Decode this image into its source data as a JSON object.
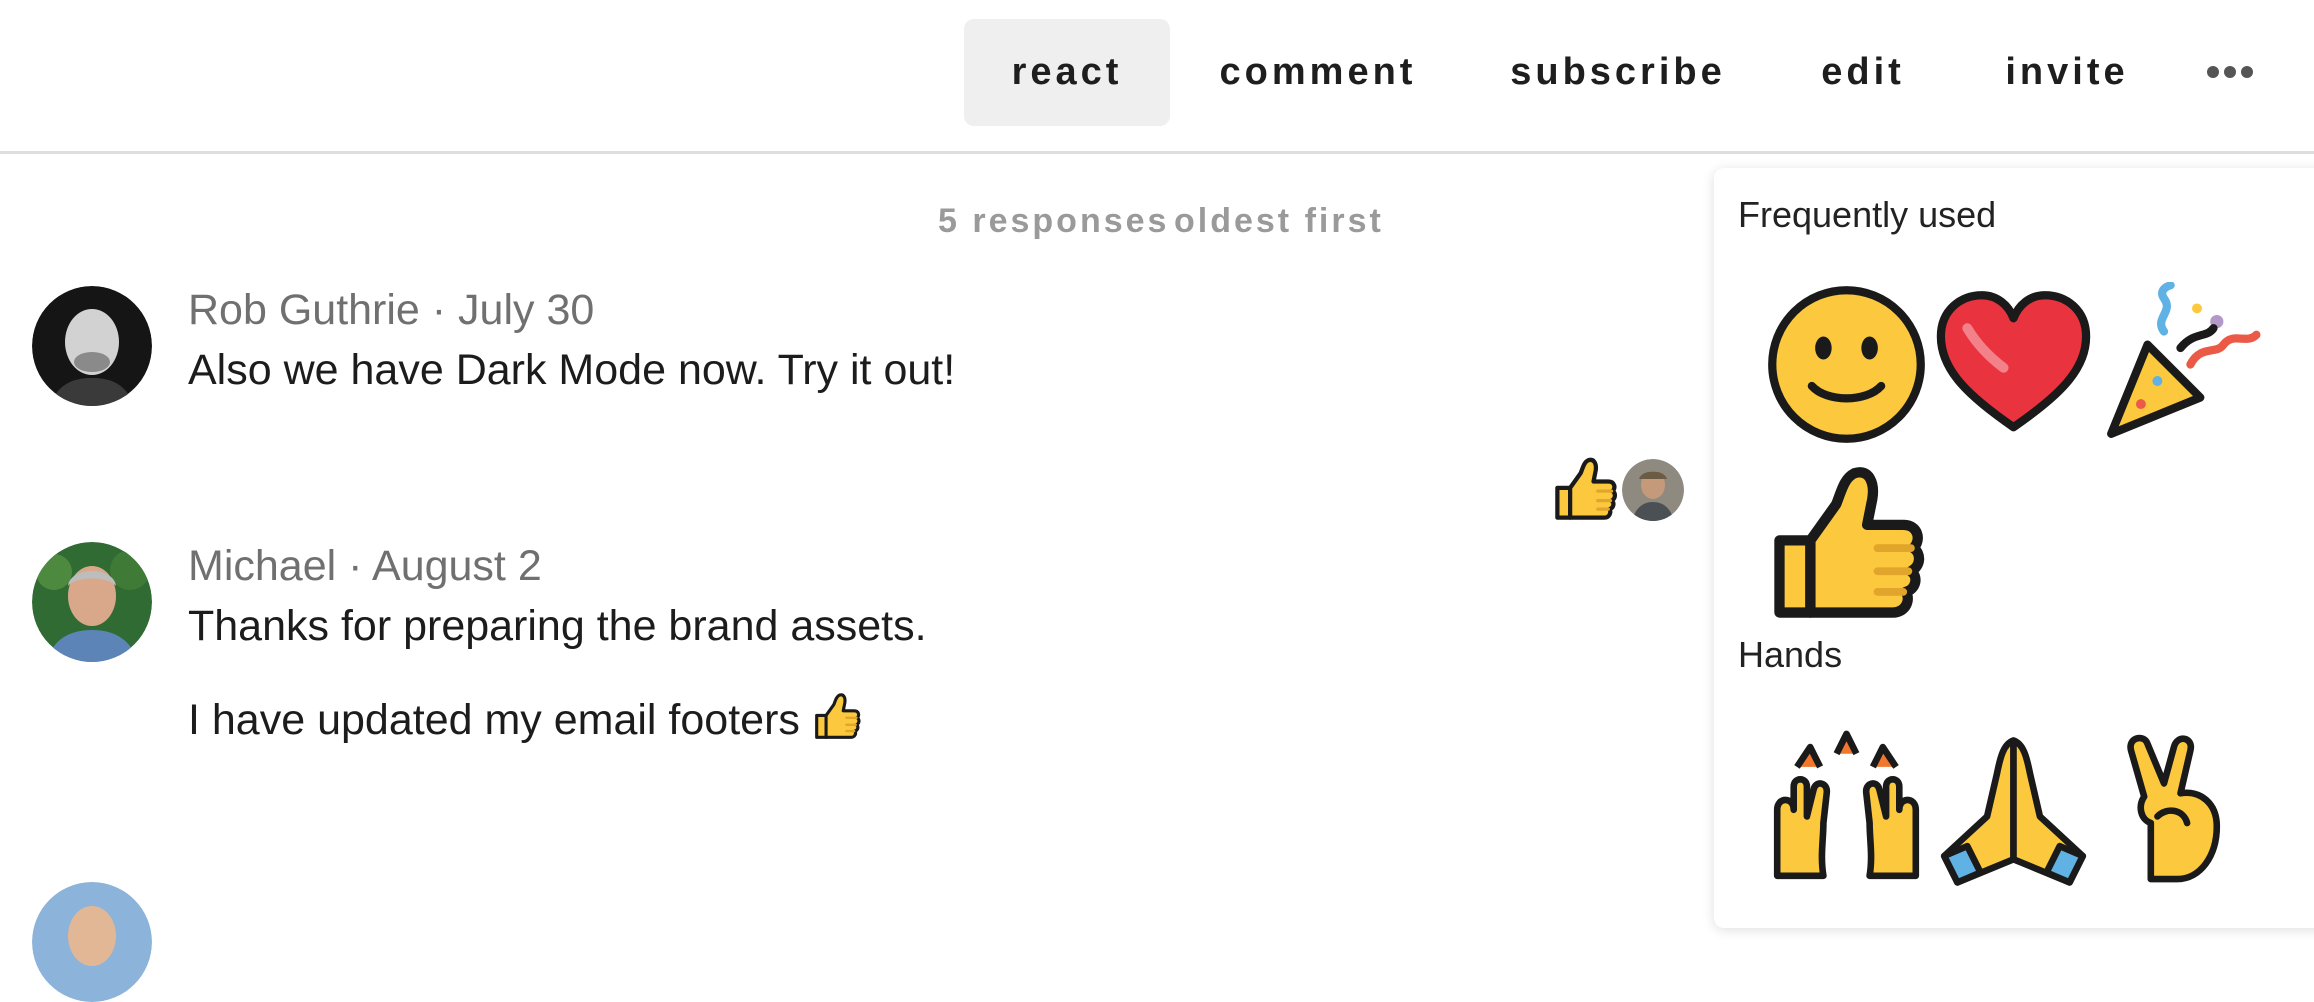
{
  "toolbar": {
    "tabs": [
      {
        "label": "react",
        "active": true
      },
      {
        "label": "comment"
      },
      {
        "label": "subscribe"
      },
      {
        "label": "edit"
      },
      {
        "label": "invite"
      }
    ],
    "more_icon": "ellipsis-icon"
  },
  "thread": {
    "response_count": "5 responses",
    "sort_order": "oldest first"
  },
  "comments": [
    {
      "author": "Rob Guthrie · July 30",
      "lines": [
        "Also we have Dark Mode now. Try it out!"
      ],
      "reaction_icon": "thumbs-up-icon"
    },
    {
      "author": "Michael · August 2",
      "lines": [
        "Thanks for preparing the brand assets.",
        "I have updated my email footers"
      ],
      "inline_icon": "thumbs-up-icon"
    }
  ],
  "picker": {
    "sections": [
      {
        "title": "Frequently used",
        "icons": [
          "smiling-face-icon",
          "red-heart-icon",
          "party-popper-icon",
          "thumbs-up-icon"
        ]
      },
      {
        "title": "Hands",
        "icons": [
          "raising-hands-icon",
          "folded-hands-icon",
          "crossed-fingers-icon"
        ]
      }
    ]
  },
  "colors": {
    "emoji_yellow": "#fcc83d",
    "heart_red": "#e9333e",
    "outline": "#1a1a1a",
    "active_tab": "#efefef"
  }
}
